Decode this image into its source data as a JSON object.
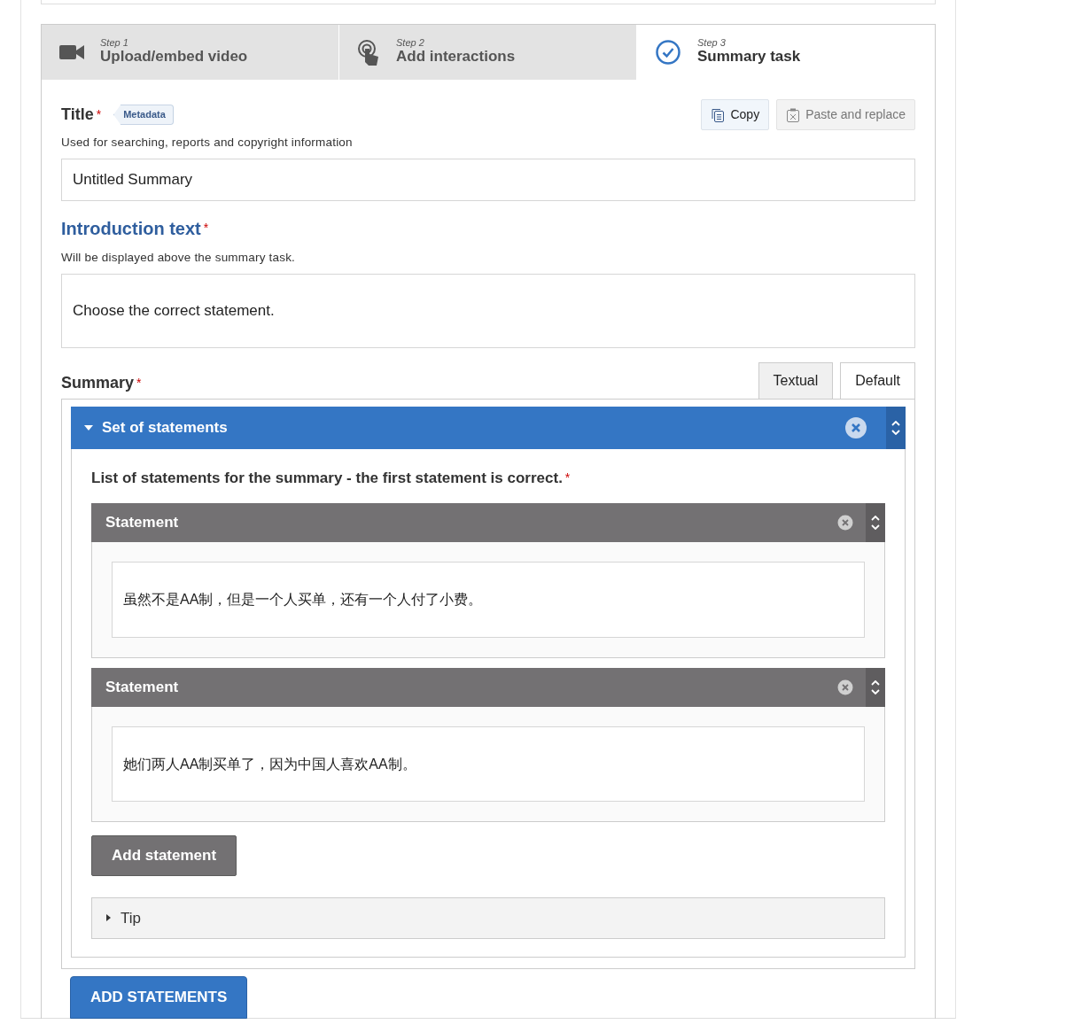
{
  "steps": [
    {
      "step": "Step 1",
      "label": "Upload/embed video",
      "kind": "video",
      "selected": false
    },
    {
      "step": "Step 2",
      "label": "Add interactions",
      "kind": "touch",
      "selected": false
    },
    {
      "step": "Step 3",
      "label": "Summary task",
      "kind": "check",
      "selected": true
    }
  ],
  "title_field": {
    "label": "Title",
    "required_mark": "*",
    "badge": "Metadata",
    "description": "Used for searching, reports and copyright information",
    "value": "Untitled Summary",
    "buttons": [
      {
        "label": "Copy",
        "kind": "copy",
        "disabled": false
      },
      {
        "label": "Paste and replace",
        "kind": "paste",
        "disabled": true
      }
    ]
  },
  "intro_field": {
    "label": "Introduction text",
    "required_mark": "*",
    "description": "Will be displayed above the summary task.",
    "value": "Choose the correct statement."
  },
  "summary": {
    "label": "Summary",
    "required_mark": "*",
    "tabs": [
      {
        "label": "Textual",
        "selected": false
      },
      {
        "label": "Default",
        "selected": true
      }
    ],
    "group": {
      "title": "Set of statements",
      "expanded": true,
      "list_label": "List of statements for the summary - the first statement is correct.",
      "required_mark": "*",
      "statements": [
        {
          "title": "Statement",
          "value": "虽然不是AA制，但是一个人买单，还有一个人付了小费。"
        },
        {
          "title": "Statement",
          "value": "她们两人AA制买单了，因为中国人喜欢AA制。"
        }
      ],
      "add_button": "Add statement",
      "tip": {
        "label": "Tip",
        "expanded": false
      }
    }
  },
  "add_statements_button": "ADD STATEMENTS"
}
